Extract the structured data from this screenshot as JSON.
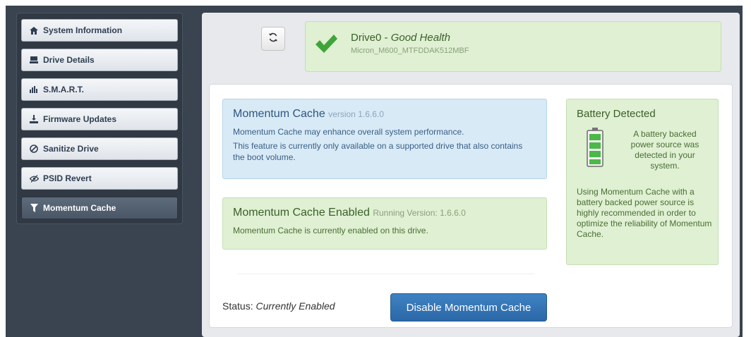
{
  "sidebar": {
    "items": [
      {
        "label": "System Information",
        "icon": "home-icon"
      },
      {
        "label": "Drive Details",
        "icon": "drive-icon"
      },
      {
        "label": "S.M.A.R.T.",
        "icon": "bar-chart-icon"
      },
      {
        "label": "Firmware Updates",
        "icon": "download-icon"
      },
      {
        "label": "Sanitize Drive",
        "icon": "ban-icon"
      },
      {
        "label": "PSID Revert",
        "icon": "eye-slash-icon"
      },
      {
        "label": "Momentum Cache",
        "icon": "filter-icon"
      }
    ],
    "active": "Momentum Cache"
  },
  "drive": {
    "name": "Drive0 - ",
    "health": "Good Health",
    "model": "Micron_M600_MTFDDAK512MBF"
  },
  "info": {
    "title": "Momentum Cache",
    "version": "version 1.6.6.0",
    "text1": "Momentum Cache may enhance overall system performance.",
    "text2": "This feature is currently only available on a supported drive that also contains the boot volume."
  },
  "enabled": {
    "title": "Momentum Cache Enabled",
    "running": "Running Version: 1.6.6.0",
    "text": "Momentum Cache is currently enabled on this drive."
  },
  "battery": {
    "title": "Battery Detected",
    "text1": "A battery backed power source was detected in your system.",
    "text2": "Using Momentum Cache with a battery backed power source is highly recommended in order to optimize the reliability of Momentum Cache."
  },
  "status": {
    "label": "Status: ",
    "value": "Currently Enabled"
  },
  "buttons": {
    "disable": "Disable Momentum Cache"
  },
  "colors": {
    "accent": "#2a68a8",
    "success_bg": "#dff0d3",
    "info_bg": "#d8eaf6",
    "sidebar_bg": "#3a4350"
  }
}
